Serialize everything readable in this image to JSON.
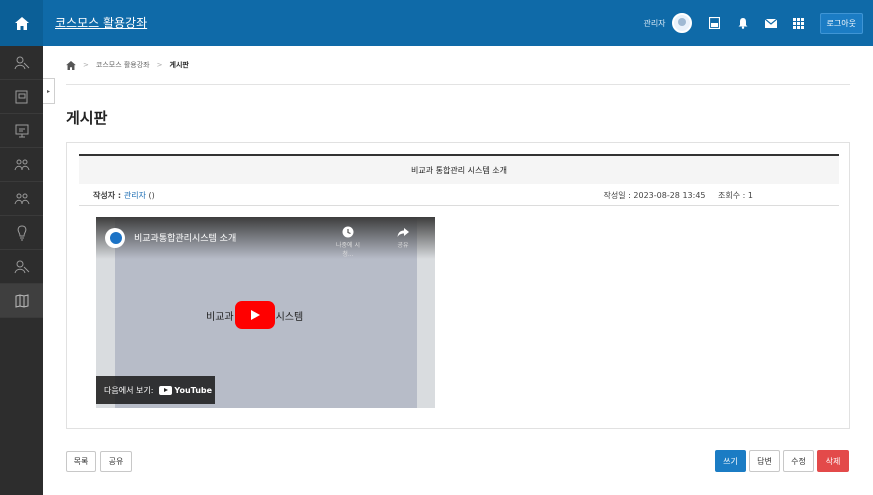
{
  "header": {
    "course_title": "코스모스 활용강좌",
    "user_name": "관리자",
    "logout_label": "로그아웃"
  },
  "sidebar": {
    "items": [
      {
        "icon": "user-icon"
      },
      {
        "icon": "course-book-icon"
      },
      {
        "icon": "presentation-icon"
      },
      {
        "icon": "group-icon"
      },
      {
        "icon": "group-icon"
      },
      {
        "icon": "lightbulb-icon"
      },
      {
        "icon": "user-icon"
      },
      {
        "icon": "map-icon",
        "active": true
      }
    ]
  },
  "breadcrumb": {
    "items": [
      "코스모스 활용강좌",
      "게시판"
    ]
  },
  "page_title": "게시판",
  "post": {
    "title": "비교과 통합관리 시스템 소개",
    "author_label": "작성자 : ",
    "author_name": "관리자",
    "author_suffix": " ()",
    "date_label": "작성일 : 2023-08-28 13:45",
    "views_label": "조회수 : 1"
  },
  "video": {
    "title": "비교과통합관리시스템 소개",
    "watch_later": "나중에 시청...",
    "share": "공유",
    "center_left": "비교과",
    "center_right": "시스템",
    "watch_on": "다음에서 보기:",
    "youtube": "YouTube"
  },
  "buttons": {
    "list": "목록",
    "share": "공유",
    "write": "쓰기",
    "reply": "답변",
    "edit": "수정",
    "delete": "삭제"
  }
}
